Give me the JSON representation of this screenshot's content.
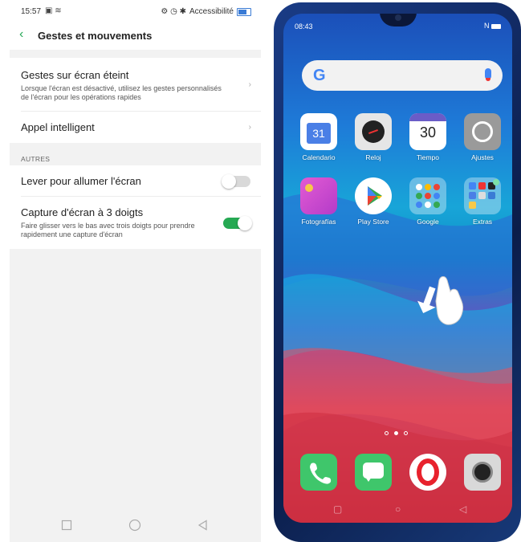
{
  "left": {
    "status": {
      "time": "15:57",
      "accessibility": "Accessibilité"
    },
    "header": {
      "title": "Gestes et mouvements"
    },
    "rows": {
      "gestures": {
        "label": "Gestes sur écran éteint",
        "desc": "Lorsque l'écran est désactivé, utilisez les gestes personnalisés de l'écran pour les opérations rapides"
      },
      "smart_call": {
        "label": "Appel intelligent"
      },
      "section_others": "AUTRES",
      "raise_wake": {
        "label": "Lever pour allumer l'écran",
        "enabled": false
      },
      "screenshot3": {
        "label": "Capture d'écran à 3 doigts",
        "desc": "Faire glisser vers le bas avec trois doigts pour prendre rapidement une capture d'écran",
        "enabled": true
      }
    },
    "accent_color": "#26a953"
  },
  "phone": {
    "status": {
      "time": "08:43",
      "nfc": "N"
    },
    "search": {
      "logo": "G"
    },
    "apps_row1": [
      {
        "name": "Calendario",
        "icon": "calendar-icon",
        "value": "31"
      },
      {
        "name": "Reloj",
        "icon": "clock-icon"
      },
      {
        "name": "Tiempo",
        "icon": "weather-icon",
        "value": "30"
      },
      {
        "name": "Ajustes",
        "icon": "settings-icon"
      }
    ],
    "apps_row2": [
      {
        "name": "Fotografías",
        "icon": "photos-icon"
      },
      {
        "name": "Play Store",
        "icon": "play-store-icon"
      },
      {
        "name": "Google",
        "icon": "google-folder-icon"
      },
      {
        "name": "Extras",
        "icon": "extras-folder-icon"
      }
    ],
    "dock": [
      {
        "icon": "phone-icon"
      },
      {
        "icon": "messages-icon"
      },
      {
        "icon": "opera-icon"
      },
      {
        "icon": "camera-icon"
      }
    ],
    "page_indicator": {
      "pages": 3,
      "current": 2
    }
  }
}
